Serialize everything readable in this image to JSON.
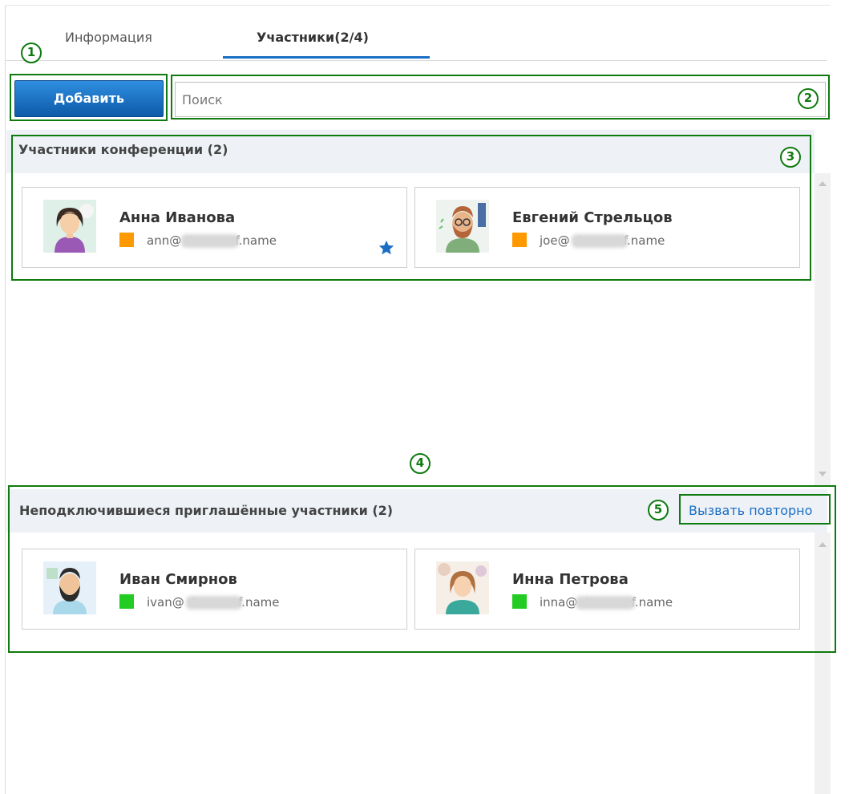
{
  "tabs": [
    {
      "label": "Информация",
      "active": false
    },
    {
      "label": "Участники(2/4)",
      "active": true
    }
  ],
  "toolbar": {
    "add_label": "Добавить",
    "search_placeholder": "Поиск",
    "search_value": ""
  },
  "conference": {
    "title": "Участники конференции (2)",
    "participants": [
      {
        "name": "Анна Иванова",
        "email": "ann@      .trueconf.name",
        "status_color": "#ff9900",
        "owner": true
      },
      {
        "name": "Евгений Стрельцов",
        "email": "joe@      .trueconf.name",
        "status_color": "#ff9900",
        "owner": false
      }
    ]
  },
  "invited": {
    "title": "Неподключившиеся приглашённые участники (2)",
    "recall_label": "Вызвать повторно",
    "participants": [
      {
        "name": "Иван Смирнов",
        "email": "ivan@      .trueconf.name",
        "status_color": "#22cc22"
      },
      {
        "name": "Инна Петрова",
        "email": "inna@      .trueconf.name",
        "status_color": "#22cc22"
      }
    ]
  },
  "callouts": [
    "1",
    "2",
    "3",
    "4",
    "5"
  ],
  "colors": {
    "accent": "#1a6fc4",
    "callout_green": "#0f7a0f",
    "status_busy": "#ff9900",
    "status_online": "#22cc22"
  },
  "icons": [
    "star-icon",
    "scroll-up-icon",
    "scroll-down-icon",
    "avatar"
  ]
}
